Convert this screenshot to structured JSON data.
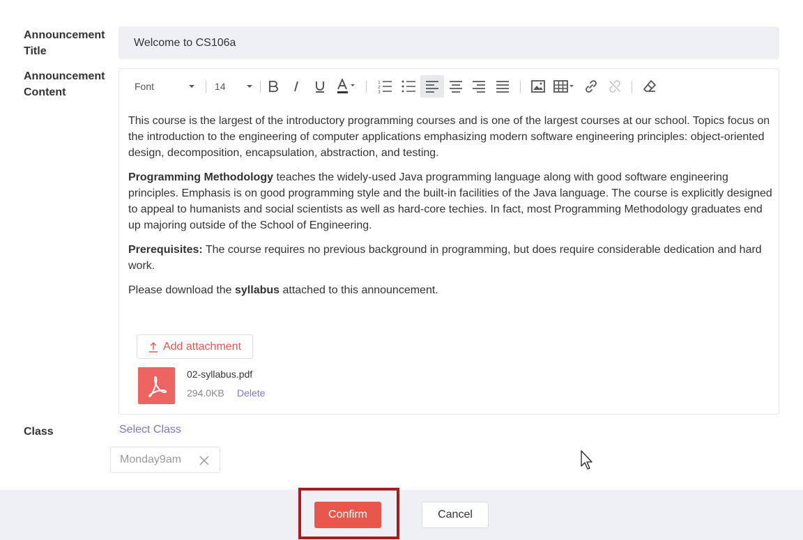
{
  "form": {
    "title_label_line1": "Announcement",
    "title_label_line2": "Title",
    "content_label_line1": "Announcement",
    "content_label_line2": "Content",
    "class_label": "Class",
    "title_value": "Welcome to CS106a"
  },
  "toolbar": {
    "font_select": "Font",
    "size_select": "14",
    "selected_alignment": "align-left"
  },
  "content": {
    "p1": "This course is the largest of the introductory programming courses and is one of the largest courses at our school. Topics focus on the introduction to the engineering of computer applications emphasizing modern software engineering principles: object-oriented design, decomposition, encapsulation, abstraction, and testing.",
    "p2_bold": "Programming Methodology",
    "p2_rest": " teaches the widely-used Java programming language along with good software engineering principles. Emphasis is on good programming style and the built-in facilities of the Java language. The course is explicitly designed to appeal to humanists and social scientists as well as hard-core techies. In fact, most Programming Methodology graduates end up majoring outside of the School of Engineering.",
    "p3_bold": "Prerequisites:",
    "p3_rest": " The course requires no previous background in programming, but does require considerable dedication and hard work.",
    "p4_pre": "Please download the ",
    "p4_bold": "syllabus",
    "p4_post": " attached to this announcement."
  },
  "attachment": {
    "add_label": "Add attachment",
    "file_name": "02-syllabus.pdf",
    "file_size": "294.0KB",
    "delete_label": "Delete",
    "icon": "pdf-icon"
  },
  "class": {
    "select_label": "Select Class",
    "chips": [
      "Monday9am"
    ]
  },
  "footer": {
    "confirm_label": "Confirm",
    "cancel_label": "Cancel"
  },
  "colors": {
    "accent": "#e9564b",
    "link": "#7b74d6",
    "highlight_box": "#a51d1d",
    "footer_bg": "#eff0f6"
  }
}
